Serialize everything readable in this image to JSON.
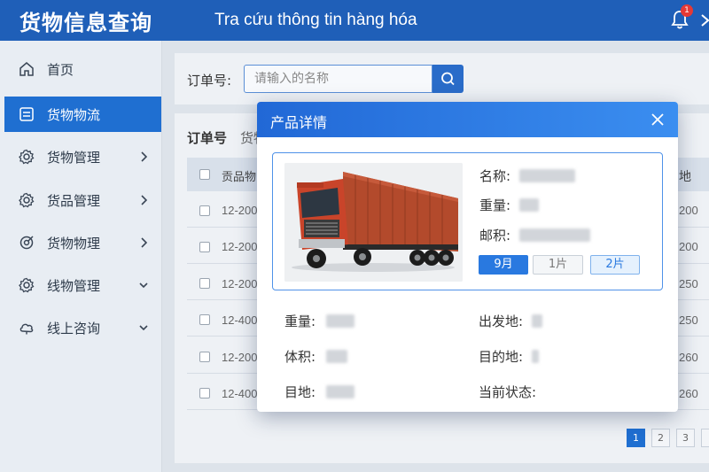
{
  "header": {
    "title": "货物信息查询",
    "subtitle": "Tra cứu thông tin hàng hóa",
    "notification_count": "1"
  },
  "sidebar": {
    "items": [
      {
        "label": "首页",
        "icon": "home-icon"
      },
      {
        "label": "货物物流",
        "icon": "document-icon",
        "active": true
      },
      {
        "label": "货物管理",
        "icon": "gear-icon"
      },
      {
        "label": "货品管理",
        "icon": "gear-icon"
      },
      {
        "label": "货物物理",
        "icon": "target-icon"
      },
      {
        "label": "线物管理",
        "icon": "gear-icon"
      },
      {
        "label": "线上咨询",
        "icon": "cloud-icon"
      }
    ]
  },
  "search": {
    "label": "订单号:",
    "placeholder": "请输入的名称"
  },
  "table": {
    "tab_label": "订单号",
    "tab_label_2": "货物",
    "header_left": "贡品物",
    "header_right": "地",
    "rows": [
      {
        "left": "12-200",
        "right": "200"
      },
      {
        "left": "12-200",
        "right": "200"
      },
      {
        "left": "12-200",
        "right": "250"
      },
      {
        "left": "12-400",
        "right": "250"
      },
      {
        "left": "12-200",
        "right": "260"
      },
      {
        "left": "12-400",
        "right": "260"
      }
    ]
  },
  "pagination": [
    "1",
    "2",
    "3"
  ],
  "modal": {
    "title": "产品详情",
    "name_label": "名称:",
    "weight_label": "重量:",
    "volume_label": "邮积:",
    "pills": [
      "9月",
      "1片",
      "2片"
    ],
    "details": {
      "weight": "重量:",
      "volume": "体积:",
      "dest": "目地:",
      "origin": "出发地:",
      "destination": "目的地:",
      "status": "当前状态:"
    }
  },
  "colors": {
    "header_bg": "#1f5fb8",
    "accent": "#1f6fd1",
    "modal_header": "#2168d6"
  }
}
